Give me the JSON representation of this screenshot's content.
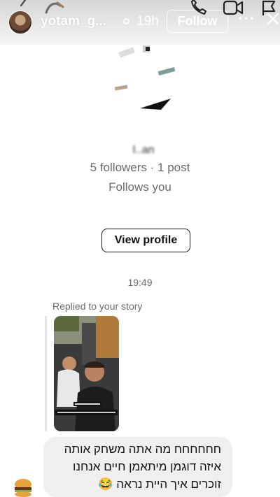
{
  "header": {
    "username": "yotam_g...",
    "time_ago": "19h",
    "follow_label": "Follow",
    "more_label": "···"
  },
  "profile": {
    "name_blurred": "I‌..an‌  ",
    "stats": "5 followers · 1 post",
    "follows_you": "Follows you",
    "view_profile_label": "View profile"
  },
  "thread": {
    "timestamp": "19:49",
    "replied_label": "Replied to your story",
    "message_lines": [
      "חחחחחח מה אתה משחק אותה",
      "איזה דוגמן מיתאמן חיים אנחנו",
      "זוכרים איך היית נראה 😂"
    ]
  },
  "colors": {
    "accent_text": "#111111",
    "muted_text": "#6b6b6b",
    "bubble_bg": "#efefef"
  },
  "icons": [
    "back-icon",
    "phone-icon",
    "video-icon",
    "flag-icon",
    "close-icon",
    "more-icon"
  ]
}
